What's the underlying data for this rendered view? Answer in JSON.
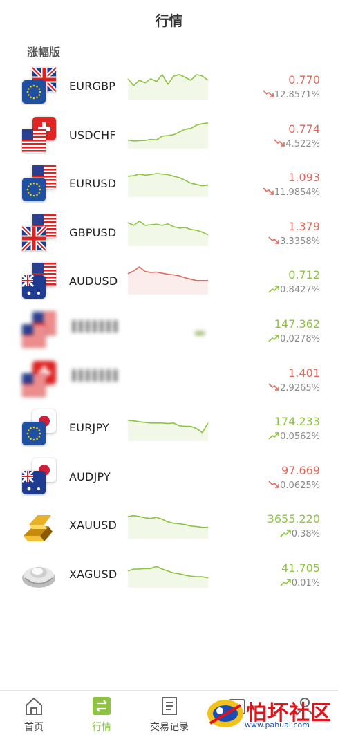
{
  "header": {
    "title": "行情"
  },
  "section": {
    "title": "涨幅版"
  },
  "colors": {
    "up": "#8cc43f",
    "down": "#e06a5c"
  },
  "quotes": [
    {
      "symbol": "EURGBP",
      "price": "0.770",
      "change": "12.8571%",
      "dir": "down",
      "flag": "eurgbp",
      "spark": [
        0.3,
        0.55,
        0.35,
        0.45,
        0.3,
        0.4,
        0.15,
        0.5,
        0.2,
        0.15,
        0.25,
        0.35,
        0.15,
        0.2,
        0.35
      ],
      "spark_color": "#8cc43f"
    },
    {
      "symbol": "USDCHF",
      "price": "0.774",
      "change": "4.522%",
      "dir": "down",
      "flag": "usdchf",
      "spark": [
        0.75,
        0.78,
        0.77,
        0.76,
        0.72,
        0.74,
        0.6,
        0.58,
        0.55,
        0.45,
        0.35,
        0.32,
        0.2,
        0.15,
        0.12
      ],
      "spark_color": "#8cc43f"
    },
    {
      "symbol": "EURUSD",
      "price": "1.093",
      "change": "11.9854%",
      "dir": "down",
      "flag": "eurusd",
      "spark": [
        0.3,
        0.28,
        0.22,
        0.26,
        0.24,
        0.2,
        0.22,
        0.24,
        0.3,
        0.35,
        0.45,
        0.55,
        0.6,
        0.65,
        0.62
      ],
      "spark_color": "#8cc43f"
    },
    {
      "symbol": "GBPUSD",
      "price": "1.379",
      "change": "3.3358%",
      "dir": "down",
      "flag": "gbpusd",
      "spark": [
        0.2,
        0.3,
        0.15,
        0.3,
        0.28,
        0.26,
        0.3,
        0.25,
        0.35,
        0.4,
        0.38,
        0.45,
        0.48,
        0.55,
        0.65
      ],
      "spark_color": "#8cc43f"
    },
    {
      "symbol": "AUDUSD",
      "price": "0.712",
      "change": "0.8427%",
      "dir": "up",
      "flag": "audusd",
      "spark": [
        0.3,
        0.2,
        0.05,
        0.22,
        0.25,
        0.24,
        0.28,
        0.32,
        0.34,
        0.38,
        0.45,
        0.5,
        0.55,
        0.55,
        0.55
      ],
      "spark_color": "#e06a5c"
    },
    {
      "symbol": "",
      "price": "147.362",
      "change": "0.0278%",
      "dir": "up",
      "flag": "blur1",
      "spark": [],
      "spark_color": "#8cc43f"
    },
    {
      "symbol": "",
      "price": "1.401",
      "change": "2.9265%",
      "dir": "down",
      "flag": "blur2",
      "spark": [],
      "spark_color": "#8cc43f"
    },
    {
      "symbol": "EURJPY",
      "price": "174.233",
      "change": "0.0562%",
      "dir": "up",
      "flag": "eurjpy",
      "spark": [
        0.3,
        0.32,
        0.35,
        0.38,
        0.4,
        0.4,
        0.4,
        0.42,
        0.4,
        0.5,
        0.52,
        0.52,
        0.6,
        0.75,
        0.4
      ],
      "spark_color": "#8cc43f"
    },
    {
      "symbol": "AUDJPY",
      "price": "97.669",
      "change": "0.0625%",
      "dir": "down",
      "flag": "audjpy",
      "spark": [],
      "spark_color": "#8cc43f"
    },
    {
      "symbol": "XAUUSD",
      "price": "3655.220",
      "change": "0.38%",
      "dir": "up",
      "flag": "gold",
      "spark": [
        0.25,
        0.22,
        0.25,
        0.3,
        0.32,
        0.28,
        0.35,
        0.45,
        0.5,
        0.52,
        0.55,
        0.6,
        0.62,
        0.65,
        0.65
      ],
      "spark_color": "#8cc43f"
    },
    {
      "symbol": "XAGUSD",
      "price": "41.705",
      "change": "0.01%",
      "dir": "up",
      "flag": "silver",
      "spark": [
        0.45,
        0.38,
        0.38,
        0.36,
        0.36,
        0.28,
        0.38,
        0.45,
        0.52,
        0.55,
        0.6,
        0.64,
        0.66,
        0.66,
        0.7
      ],
      "spark_color": "#8cc43f"
    }
  ],
  "tabs": [
    {
      "label": "首页",
      "icon": "home-icon"
    },
    {
      "label": "行情",
      "icon": "exchange-icon"
    },
    {
      "label": "交易记录",
      "icon": "document-icon"
    },
    {
      "label": "",
      "icon": "wallet-icon"
    },
    {
      "label": "",
      "icon": "user-icon"
    }
  ],
  "watermark": {
    "title": "怕坏社区",
    "url": "www.pahuai.com"
  }
}
